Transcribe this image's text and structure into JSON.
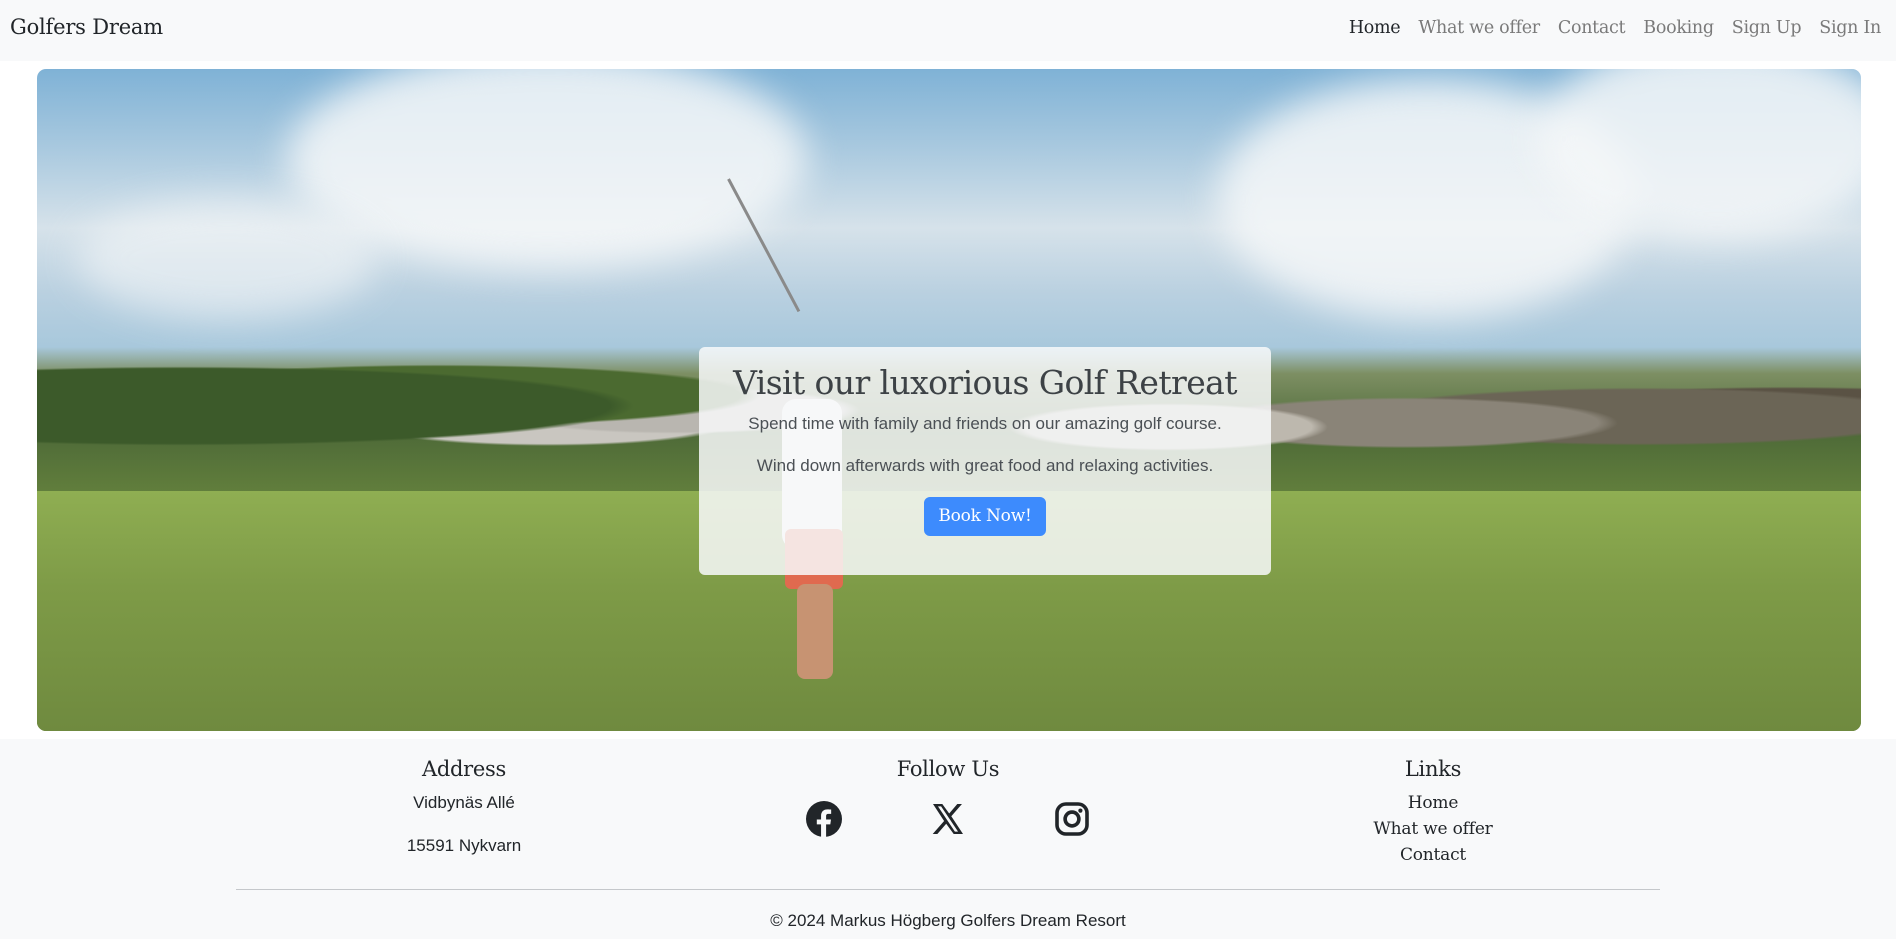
{
  "navbar": {
    "brand": "Golfers Dream",
    "links": [
      {
        "label": "Home",
        "active": true
      },
      {
        "label": "What we offer",
        "active": false
      },
      {
        "label": "Contact",
        "active": false
      },
      {
        "label": "Booking",
        "active": false
      },
      {
        "label": "Sign Up",
        "active": false
      },
      {
        "label": "Sign In",
        "active": false
      }
    ]
  },
  "hero": {
    "title": "Visit our luxorious Golf Retreat",
    "text1": "Spend time with family and friends on our amazing golf course.",
    "text2": "Wind down afterwards with great food and relaxing activities.",
    "button": "Book Now!",
    "button_color": "#3d8bfd"
  },
  "footer": {
    "address": {
      "heading": "Address",
      "line1": "Vidbynäs Allé",
      "line2": "15591 Nykvarn"
    },
    "follow": {
      "heading": "Follow Us",
      "icons": [
        "facebook-icon",
        "x-icon",
        "instagram-icon"
      ]
    },
    "links": {
      "heading": "Links",
      "items": [
        "Home",
        "What we offer",
        "Contact"
      ]
    },
    "copyright": "© 2024 Markus Högberg Golfers Dream Resort"
  }
}
